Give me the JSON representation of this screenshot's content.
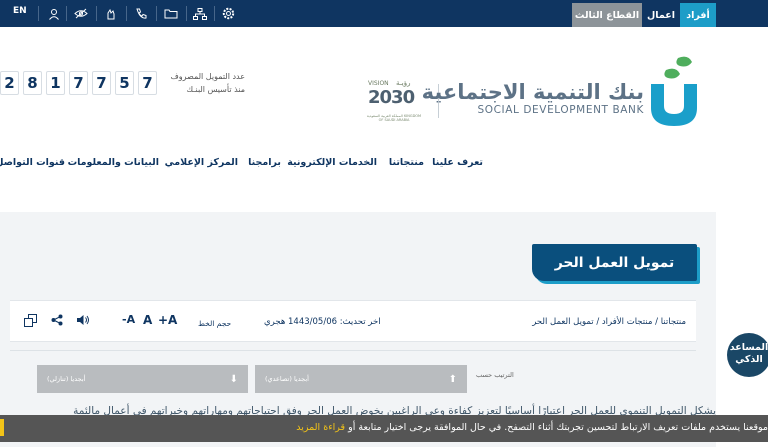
{
  "topbar": {
    "lang": "EN",
    "tabs": {
      "third_sector": "القطاع الثالث",
      "business": "اعمال",
      "individuals": "أفراد"
    }
  },
  "header": {
    "counter_digits": [
      "2",
      "8",
      "1",
      "7",
      "7",
      "5",
      "7"
    ],
    "counter_label_1": "عدد التمويل المصروف",
    "counter_label_2": "منذ تأسيس البنـك",
    "vision_word": "VISION",
    "vision_ar": "رؤيـة",
    "vision_year": "2030",
    "vision_sub": "المملكة العربية السعودية KINGDOM OF SAUDI ARABIA",
    "bank_name_ar": "بنك التنمية الاجتماعية",
    "bank_name_en": "SOCIAL DEVELOPMENT BANK"
  },
  "nav": {
    "about": "تعرف علينا",
    "products": "منتجاتنا",
    "eservices": "الخدمات الإلكترونية",
    "programs": "برامجنا",
    "media": "المركز الإعلامي",
    "data": "البيانات والمعلومات",
    "channels": "قنوات التواصل"
  },
  "page": {
    "title": "تمويل العمل الحر",
    "breadcrumb": "منتجاتنا / منتجات الأفراد / تمويل العمل الحر",
    "last_update": "اخر تحديث: 1443/05/06 هجري",
    "font_size_label": "حجم الخط",
    "font_plus": "+A",
    "font_normal": "A",
    "font_minus": "-A",
    "sort_label": "الترتيب حسب",
    "sort_asc": "أبجديا (تصاعدي)",
    "sort_desc": "أبجديا (تنازلي)",
    "body_text": "يشكل التمويل التنموي للعمل الحر اعتبارًا أساسيًا لتعزيز كفاءة وعي الراغبين بخوض العمل الحر وفق احتياجاتهم ومهاراتهم وخبراتهم في أعمال مالئمة"
  },
  "assistant": {
    "line1": "المساعد",
    "line2": "الذكي"
  },
  "cookie": {
    "text": "موقعنا يستخدم ملفات تعريف الارتباط لتحسين تجربتك أثناء التصفح. في حال الموافقة يرجى اختيار متابعة أو ",
    "link": "قراءة المزيد"
  },
  "colors": {
    "navy": "#0f3561",
    "accent": "#1d9dc8",
    "logo_green": "#4fae5d",
    "cookie_yellow": "#f2c318"
  }
}
